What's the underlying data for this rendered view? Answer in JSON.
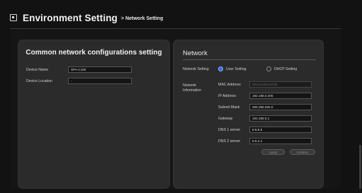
{
  "header": {
    "title": "Environment Setting",
    "crumb": "> Network Setting"
  },
  "common": {
    "title": "Common network configurations setting",
    "device_name_label": "Device Name",
    "device_name_value": "SPA-C100",
    "device_location_label": "Device Location",
    "device_location_value": "-"
  },
  "network": {
    "title": "Network",
    "setting_label": "Network Setting",
    "options": [
      "User Setting",
      "DHCP Setting"
    ],
    "selected": "User Setting",
    "info_label_1": "Network",
    "info_label_2": "Information",
    "mac_label": "MAC Address",
    "mac_value": "001e11d33:3d:3b",
    "ip_label": "IP Address",
    "ip_value": "192.168.0.205",
    "subnet_label": "Subnet Mask",
    "subnet_value": "255.255.255.0",
    "gateway_label": "Gateway",
    "gateway_value": "192.168.0.1",
    "dns1_label": "DNS 1 server",
    "dns1_value": "8.8.8.8",
    "dns2_label": "DNS 2 server",
    "dns2_value": "8.8.4.4",
    "apply_label": "Apply",
    "initialize_label": "Initialize"
  },
  "colors": {
    "accent": "#2f6fe0",
    "panel": "#2b2b2b",
    "background": "#121212"
  }
}
